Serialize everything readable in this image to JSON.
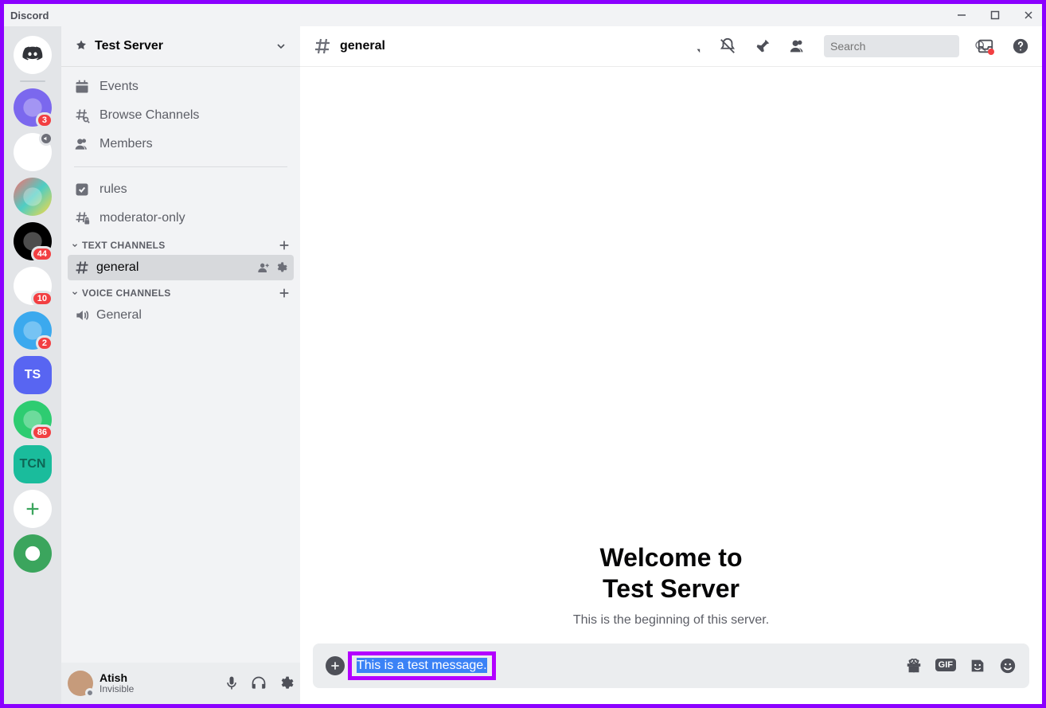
{
  "app": {
    "name": "Discord"
  },
  "servers": [
    {
      "icon": "discord-logo",
      "bg": "#ffffff",
      "fg": "#313338"
    },
    {
      "icon": "wave",
      "bg": "#7b68ee",
      "badge": "3"
    },
    {
      "icon": "sailboat",
      "bg": "#ffffff",
      "volume": true
    },
    {
      "icon": "face-art",
      "bg": "linear-gradient(135deg,#ff6b6b,#4ecdc4,#ffd93d)"
    },
    {
      "icon": "p-logo",
      "bg": "#000000",
      "badge": "44"
    },
    {
      "icon": "triangle",
      "bg": "#ffffff",
      "badge": "10"
    },
    {
      "icon": "check-arrow",
      "bg": "#3ba9ee",
      "badge": "2"
    },
    {
      "label": "TS",
      "bg": "#5865f2",
      "rounded": true
    },
    {
      "icon": "avatar-green",
      "bg": "#2ecc71",
      "badge": "86"
    },
    {
      "label": "TCN",
      "bg": "#1abc9c",
      "fg": "#0e6655",
      "rounded": true
    },
    {
      "icon": "plus",
      "bg": "#ffffff",
      "fg": "#3ba55d"
    },
    {
      "icon": "compass",
      "bg": "#3ba55d",
      "fg": "#ffffff"
    }
  ],
  "server_header": {
    "name": "Test Server"
  },
  "quick_links": [
    {
      "icon": "calendar",
      "label": "Events"
    },
    {
      "icon": "hash-search",
      "label": "Browse Channels"
    },
    {
      "icon": "people",
      "label": "Members"
    }
  ],
  "pinned_channels": [
    {
      "icon": "check-square",
      "label": "rules"
    },
    {
      "icon": "hash-lock",
      "label": "moderator-only"
    }
  ],
  "categories": [
    {
      "name": "TEXT CHANNELS",
      "channels": [
        {
          "icon": "hash",
          "label": "general",
          "active": true
        }
      ]
    },
    {
      "name": "VOICE CHANNELS",
      "channels": [
        {
          "icon": "speaker",
          "label": "General"
        }
      ]
    }
  ],
  "user": {
    "name": "Atish",
    "status": "Invisible"
  },
  "chat": {
    "channel_name": "general",
    "search_placeholder": "Search",
    "welcome_line1": "Welcome to",
    "welcome_line2": "Test Server",
    "welcome_sub": "This is the beginning of this server."
  },
  "composer": {
    "text": "This is a test message."
  }
}
